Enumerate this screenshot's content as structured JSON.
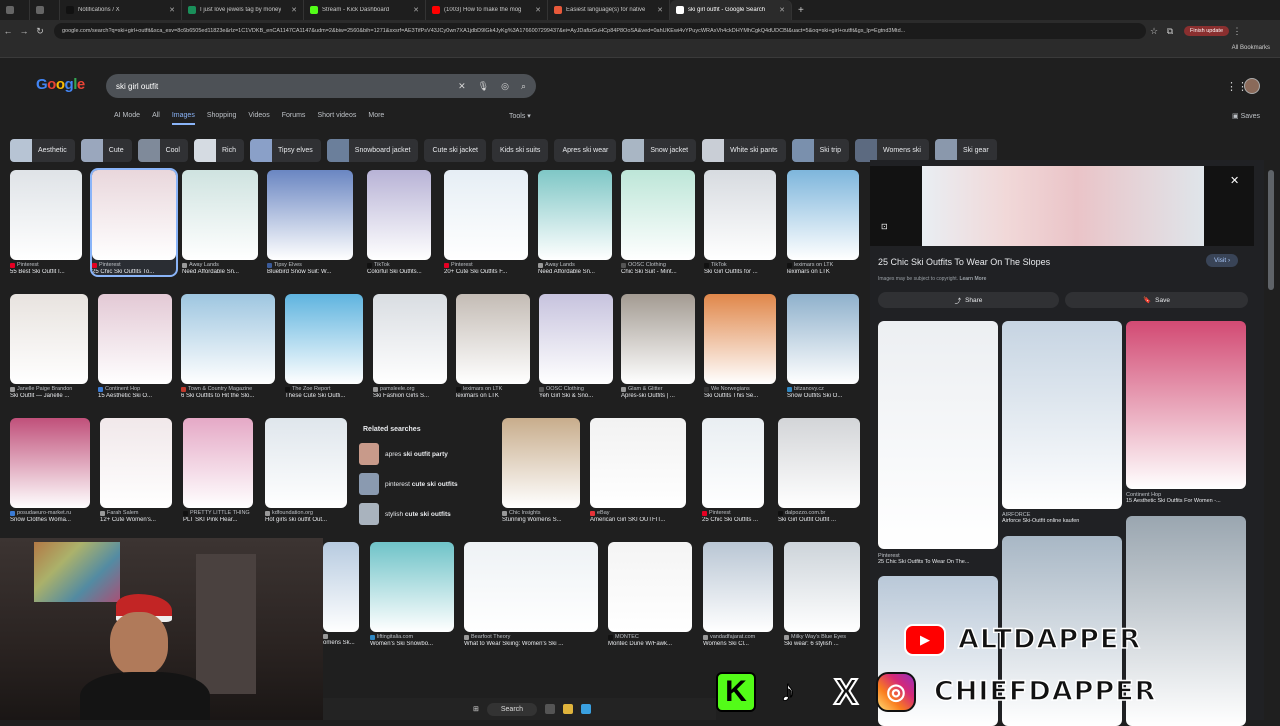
{
  "browser": {
    "tabs": [
      {
        "title": "",
        "color": "#666666"
      },
      {
        "title": "",
        "color": "#666666"
      },
      {
        "title": "Notifications / X",
        "color": "#111111"
      },
      {
        "title": "I just love jewels tag by money",
        "color": "#1a8f5a"
      },
      {
        "title": "Stream - Kick Dashboard",
        "color": "#53fc18"
      },
      {
        "title": "(1003) How to make the mog",
        "color": "#ff0000"
      },
      {
        "title": "Easiest language(s) for native",
        "color": "#e8593a"
      },
      {
        "title": "ski girl outfit - Google Search",
        "color": "#ffffff",
        "active": true
      }
    ],
    "url": "google.com/search?q=ski+girl+outfit&sca_esv=8c6b6505ed11823e&rlz=1C1VDKB_enCA1147CA1147&udm=2&biw=2560&bih=1271&sxsrf=AE3TifPsV43JCy0wn7XA1jdbD9lGk4JyKg%3A1766007299437&ei=AyJDafizGuHCp84P8OoSA&ved=0ahUKEwi4vYPuycWRAxVh4ckDHYMhCgkQ4dUDCBI&uact=5&oq=ski+girl+outfit&gs_lp=Egtnd3Mtd...",
    "finish_update": "Finish update",
    "all_bookmarks": "All Bookmarks"
  },
  "google": {
    "logo": "Google",
    "query": "ski girl outfit",
    "tabs": [
      "AI Mode",
      "All",
      "Images",
      "Shopping",
      "Videos",
      "Forums",
      "Short videos",
      "More"
    ],
    "active_tab": "Images",
    "tools": "Tools",
    "saves": "Saves"
  },
  "chips": [
    {
      "label": "Aesthetic",
      "color": "#b7c4d4"
    },
    {
      "label": "Cute",
      "color": "#9aa7bd"
    },
    {
      "label": "Cool",
      "color": "#7f8a9a"
    },
    {
      "label": "Rich",
      "color": "#d5dbe2"
    },
    {
      "label": "Tipsy elves",
      "color": "#8aa0c8"
    },
    {
      "label": "Snowboard jacket",
      "color": "#6b7f9b"
    },
    {
      "label": "Cute ski jacket",
      "color": ""
    },
    {
      "label": "Kids ski suits",
      "color": ""
    },
    {
      "label": "Apres ski wear",
      "color": ""
    },
    {
      "label": "Snow jacket",
      "color": "#a9b6c4"
    },
    {
      "label": "White ski pants",
      "color": "#c9ced6"
    },
    {
      "label": "Ski trip",
      "color": "#7a90ad"
    },
    {
      "label": "Womens ski",
      "color": "#5c6a80"
    },
    {
      "label": "Ski gear",
      "color": "#8a98ac"
    }
  ],
  "results": [
    {
      "src": "Pinterest",
      "cap": "55 Best Ski Outfit I...",
      "color": "#dfe3e7",
      "sc": "#e60023"
    },
    {
      "src": "Pinterest",
      "cap": "25 Chic Ski Outfits To...",
      "color": "#e9d7dc",
      "sc": "#e60023",
      "selected": true
    },
    {
      "src": "Away Lands",
      "cap": "Need Affordable Sn...",
      "color": "#cfe3e0",
      "sc": "#999999"
    },
    {
      "src": "Tipsy Elves",
      "cap": "Bluebird Snow Suit: W...",
      "color": "#6a86c2",
      "sc": "#3b5b9a"
    },
    {
      "src": "TikTok",
      "cap": "Colorful Ski Outfits...",
      "color": "#b8b3d6",
      "sc": "#111111"
    },
    {
      "src": "Pinterest",
      "cap": "20+ Cute Ski Outfits F...",
      "color": "#e6eef5",
      "sc": "#e60023"
    },
    {
      "src": "Away Lands",
      "cap": "Need Affordable Sn...",
      "color": "#7fc7c6",
      "sc": "#999999"
    },
    {
      "src": "OOSC Clothing",
      "cap": "Chic Ski Suit - Mint...",
      "color": "#bde6d8",
      "sc": "#555555"
    },
    {
      "src": "TikTok",
      "cap": "Ski Girl Outfits for ...",
      "color": "#d7dbe0",
      "sc": "#111111"
    },
    {
      "src": "leximars on LTK",
      "cap": "leximars on LTK",
      "color": "#7eb6dc",
      "sc": "#111111"
    },
    {
      "src": "Janelle Paige Brandon",
      "cap": "Ski Outfit — Janelle ...",
      "color": "#e8e3df",
      "sc": "#999999"
    },
    {
      "src": "Continent Hop",
      "cap": "15 Aesthetic Ski O...",
      "color": "#e3c9d5",
      "sc": "#3a7bd5"
    },
    {
      "src": "Town & Country Magazine",
      "cap": "6 Ski Outfits to Hit the Slo...",
      "color": "#9ec6e0",
      "sc": "#c0392b"
    },
    {
      "src": "The Zoe Report",
      "cap": "These Cute Ski Outfi...",
      "color": "#5fb4df",
      "sc": "#111111"
    },
    {
      "src": "pamsleele.org",
      "cap": "Ski Fashion Girls S...",
      "color": "#d9dde2",
      "sc": "#999999"
    },
    {
      "src": "leximars on LTK",
      "cap": "leximars on LTK",
      "color": "#c4bcb5",
      "sc": "#111111"
    },
    {
      "src": "OOSC Clothing",
      "cap": "Yeh Girl Ski & Sno...",
      "color": "#c7c3de",
      "sc": "#555555"
    },
    {
      "src": "Glam & Glitter",
      "cap": "Après-ski Outfits | ...",
      "color": "#a39b92",
      "sc": "#999999"
    },
    {
      "src": "We Norwegians",
      "cap": "Ski Outfits This Se...",
      "color": "#e0874a",
      "sc": "#333333"
    },
    {
      "src": "bitzanovy.cz",
      "cap": "Snow Outfits Ski O...",
      "color": "#8fb1cc",
      "sc": "#2e86c1"
    },
    {
      "src": "posudaeuro-market.ru",
      "cap": "Snow Clothes Woma...",
      "color": "#c0507a",
      "sc": "#3a7bd5"
    },
    {
      "src": "Farah Salem",
      "cap": "12+ Cute Women's...",
      "color": "#f1e8ea",
      "sc": "#999999"
    },
    {
      "src": "PRETTY LITTLE THING",
      "cap": "PLT SKI Pink Hear...",
      "color": "#e5a9c6",
      "sc": "#111111"
    },
    {
      "src": "kdfoundation.org",
      "cap": "Hot girls ski outfit Out...",
      "color": "#dfe6ec",
      "sc": "#999999"
    },
    {
      "src": "Chic Insights",
      "cap": "Stunning Womens S...",
      "color": "#c8ad8c",
      "sc": "#999999"
    },
    {
      "src": "eBay",
      "cap": "American Girl SKI OUTFIT...",
      "color": "#f2f2f2",
      "sc": "#e53238"
    },
    {
      "src": "Pinterest",
      "cap": "25 Chic Ski Outfits ...",
      "color": "#e9eef2",
      "sc": "#e60023"
    },
    {
      "src": "dalpozzo.com.br",
      "cap": "Ski Girl Outfit Outfit ...",
      "color": "#d3d5d8",
      "sc": "#111111"
    },
    {
      "src": "",
      "cap": "omens Sk...",
      "color": "#b7cbe0",
      "sc": "#999999"
    },
    {
      "src": "liftingitalia.com",
      "cap": "Women's Ski Snowbo...",
      "color": "#6fc3c8",
      "sc": "#2e86c1"
    },
    {
      "src": "Bearfoot Theory",
      "cap": "What to Wear Skiing: Women's Ski ...",
      "color": "#eef2f5",
      "sc": "#999999"
    },
    {
      "src": "MONTEC",
      "cap": "Montec Dune W/Fawk...",
      "color": "#f4f4f4",
      "sc": "#111111"
    },
    {
      "src": "vandadfajarat.com",
      "cap": "Womens Ski Cl...",
      "color": "#b9c6d4",
      "sc": "#999999"
    },
    {
      "src": "Milky Way's Blue Eyes",
      "cap": "Ski wear: 6 stylish ...",
      "color": "#cdd4da",
      "sc": "#999999"
    }
  ],
  "related": {
    "title": "Related searches",
    "items": [
      {
        "pre": "apres",
        "bold": "ski outfit party"
      },
      {
        "pre": "pinterest",
        "bold": "cute ski outfits"
      },
      {
        "pre": "stylish",
        "bold": "cute ski outfits"
      }
    ]
  },
  "preview": {
    "title": "25 Chic Ski Outfits To Wear On The Slopes",
    "visit": "Visit",
    "copyright": "Images may be subject to copyright.",
    "learn_more": "Learn More",
    "share": "Share",
    "save": "Save",
    "related": [
      {
        "src": "Pinterest",
        "cap": "25 Chic Ski Outfits To Wear On The...",
        "color": "#eceff2"
      },
      {
        "src": "AIRFORCE",
        "cap": "Airforce Ski-Outfit online kaufen",
        "color": "#c6d4e2"
      },
      {
        "src": "Continent Hop",
        "cap": "15 Aesthetic Ski Outfits For Women -...",
        "color": "#d24a73"
      },
      {
        "src": "",
        "cap": "",
        "color": "#b9c8d8"
      },
      {
        "src": "",
        "cap": "",
        "color": "#a8b7c5"
      },
      {
        "src": "",
        "cap": "",
        "color": "#9aa6b0"
      }
    ]
  },
  "overlay": {
    "line1": "ALTDAPPER",
    "line2": "CHIEFDAPPER"
  },
  "taskbar": {
    "search": "Search"
  }
}
